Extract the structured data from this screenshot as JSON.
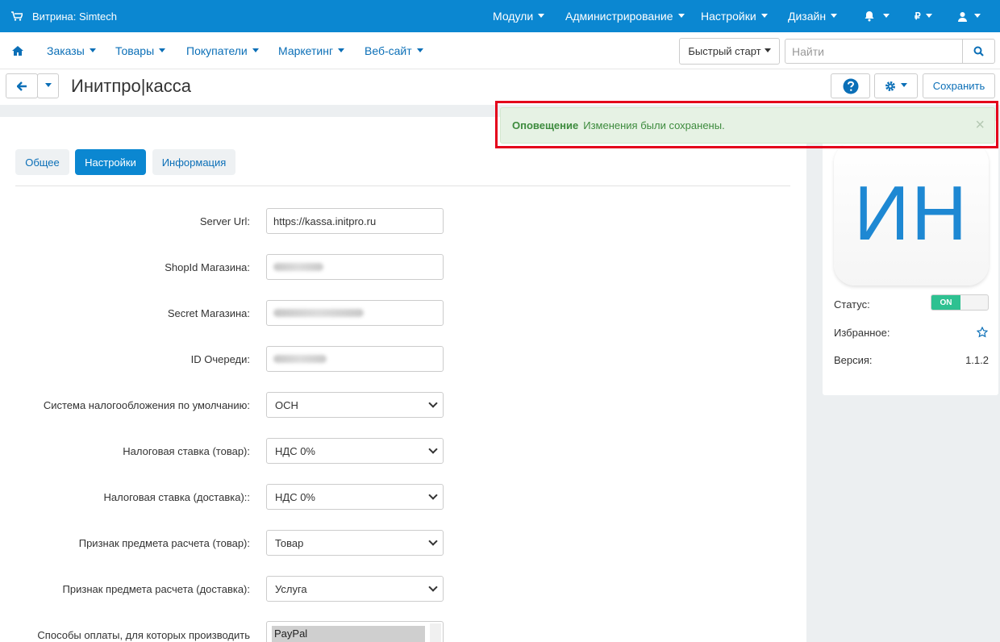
{
  "topbar": {
    "store_label": "Витрина: Simtech",
    "menu": [
      "Модули",
      "Администрирование",
      "Настройки",
      "Дизайн"
    ],
    "currency": "₽"
  },
  "navbar": {
    "items": [
      "Заказы",
      "Товары",
      "Покупатели",
      "Маркетинг",
      "Веб-сайт"
    ],
    "quick_start": "Быстрый старт",
    "search_placeholder": "Найти"
  },
  "page": {
    "title": "Инитпро|касса",
    "save_label": "Сохранить"
  },
  "tabs": [
    {
      "label": "Общее",
      "active": false
    },
    {
      "label": "Настройки",
      "active": true
    },
    {
      "label": "Информация",
      "active": false
    }
  ],
  "alert": {
    "title": "Оповещение",
    "message": "Изменения были сохранены.",
    "close": "×"
  },
  "form": {
    "server_url_label": "Server Url:",
    "server_url_value": "https://kassa.initpro.ru",
    "shop_id_label": "ShopId Магазина:",
    "secret_label": "Secret Магазина:",
    "queue_label": "ID Очереди:",
    "tax_system_label": "Система налогообложения по умолчанию:",
    "tax_system_value": "ОСН",
    "tax_rate_product_label": "Налоговая ставка (товар):",
    "tax_rate_product_value": "НДС 0%",
    "tax_rate_delivery_label": "Налоговая ставка (доставка)::",
    "tax_rate_delivery_value": "НДС 0%",
    "subject_product_label": "Признак предмета расчета (товар):",
    "subject_product_value": "Товар",
    "subject_delivery_label": "Признак предмета расчета (доставка):",
    "subject_delivery_value": "Услуга",
    "payments_label": "Способы оплаты, для которых производить",
    "payments_option": "PayPal"
  },
  "sidebar": {
    "icon_text": "ИН",
    "status_label": "Статус:",
    "status_value": "ON",
    "favorite_label": "Избранное:",
    "version_label": "Версия:",
    "version_value": "1.1.2"
  },
  "colors": {
    "primary": "#0b87d1",
    "link": "#0b6fb7",
    "success_bg": "#e6f2e4",
    "toggle_on": "#2ec191",
    "highlight": "#e4001b"
  }
}
